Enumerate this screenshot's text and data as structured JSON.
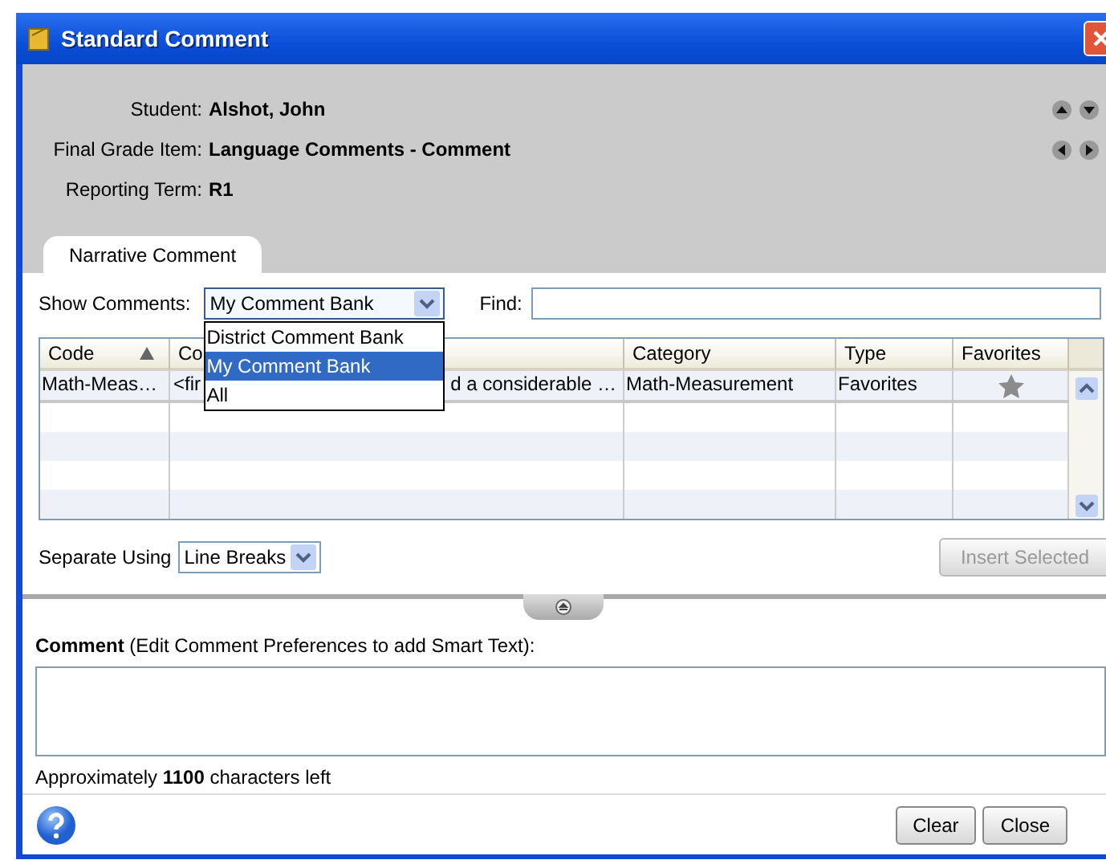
{
  "window": {
    "title": "Standard Comment"
  },
  "header": {
    "fields": [
      {
        "label": "Student:",
        "value": "Alshot, John"
      },
      {
        "label": "Final Grade Item:",
        "value": "Language Comments - Comment"
      },
      {
        "label": "Reporting Term:",
        "value": "R1"
      }
    ]
  },
  "tabs": [
    {
      "label": "Narrative Comment",
      "selected": true
    }
  ],
  "filter": {
    "label": "Show Comments:",
    "dropdown": {
      "value": "My Comment Bank",
      "expanded": true,
      "options": [
        {
          "label": "District Comment Bank",
          "selected": false
        },
        {
          "label": "My Comment Bank",
          "selected": true
        },
        {
          "label": "All",
          "selected": false
        }
      ]
    },
    "find_label": "Find:"
  },
  "table": {
    "columns": [
      {
        "label": "Code",
        "sorted": true
      },
      {
        "label": "Co",
        "sorted": false
      },
      {
        "label": "Category",
        "sorted": false
      },
      {
        "label": "Type",
        "sorted": false
      },
      {
        "label": "Favorites",
        "sorted": false
      }
    ],
    "rows": [
      {
        "code": "Math-Meas…",
        "comment_start": "<fir",
        "comment_end": "d a considerable …",
        "category": "Math-Measurement",
        "type": "Favorites",
        "favorite": true
      }
    ]
  },
  "separate": {
    "label": "Separate Using",
    "value": "Line Breaks"
  },
  "insert_button": {
    "label": "Insert Selected",
    "disabled": true
  },
  "comment": {
    "label": "**Comment** (Edit Comment Preferences to add Smart Text):",
    "chars_left": "Approximately **1100** characters left"
  },
  "buttons": [
    "Clear",
    "Close"
  ]
}
